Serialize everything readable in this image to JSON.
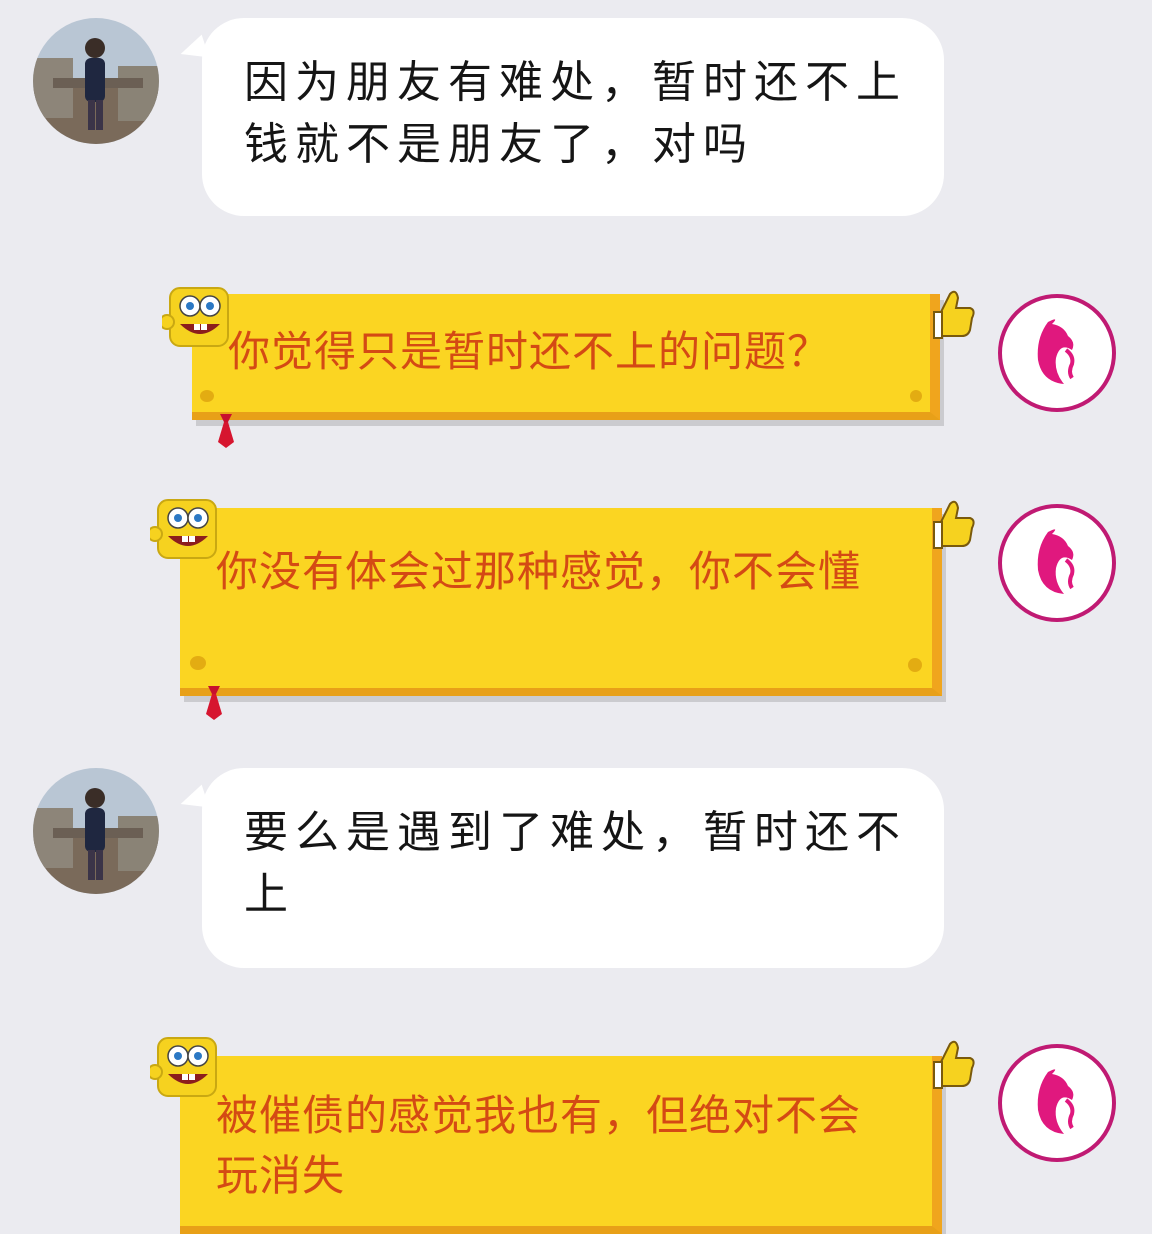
{
  "chat": {
    "messages": [
      {
        "side": "left",
        "text": "因为朋友有难处，暂时还不上钱就不是朋友了，对吗",
        "avatar": "friend-photo-avatar"
      },
      {
        "side": "right",
        "text": "你觉得只是暂时还不上的问题？",
        "avatar": "pink-silhouette-avatar"
      },
      {
        "side": "right",
        "text": "你没有体会过那种感觉，你不会懂",
        "avatar": "pink-silhouette-avatar"
      },
      {
        "side": "left",
        "text": "要么是遇到了难处，暂时还不上",
        "avatar": "friend-photo-avatar"
      },
      {
        "side": "right",
        "text": "被催债的感觉我也有，但绝对不会玩消失",
        "avatar": "pink-silhouette-avatar"
      }
    ]
  },
  "colors": {
    "background": "#ebebf0",
    "white_bubble": "#ffffff",
    "yellow_bubble": "#fbd522",
    "yellow_text": "#d44a14",
    "avatar_ring": "#c01a73"
  },
  "icons": {
    "bubble_decoration_left": "spongebob-face-icon",
    "bubble_decoration_right": "thumbs-up-icon",
    "bubble_tie": "red-tie-icon"
  }
}
